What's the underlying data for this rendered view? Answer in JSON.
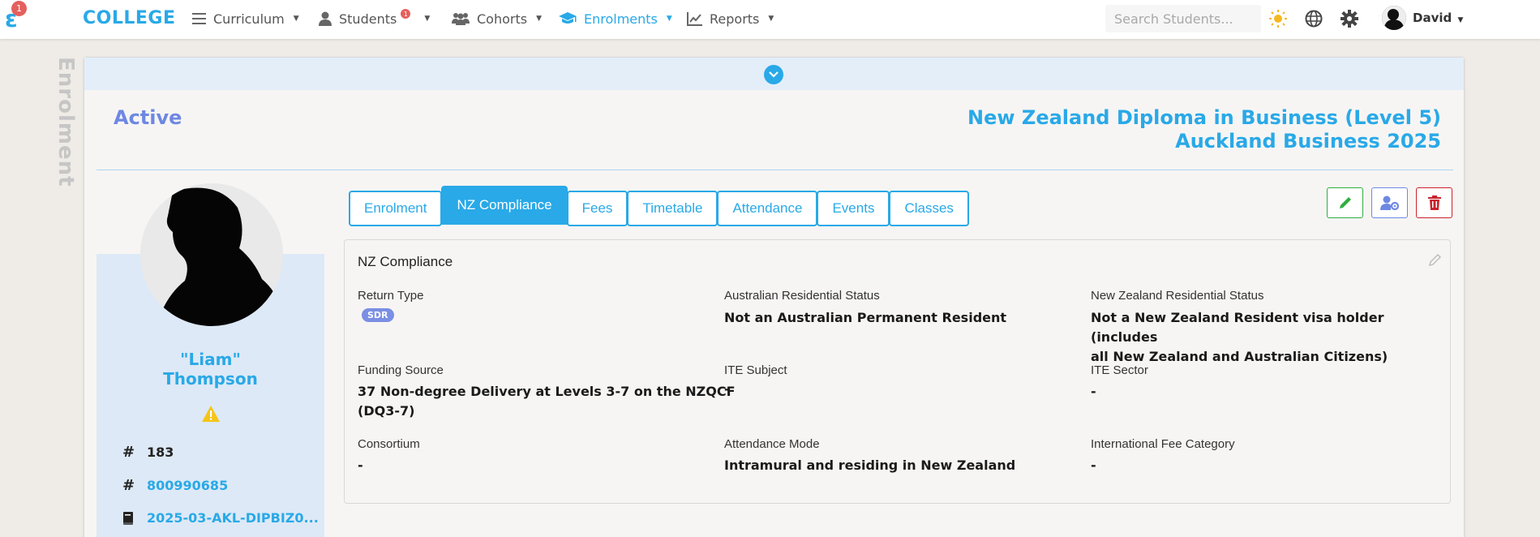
{
  "nav": {
    "brand": "COLLEGE",
    "logo_badge": "1",
    "items": [
      {
        "label": "Curriculum"
      },
      {
        "label": "Students",
        "badge": "1"
      },
      {
        "label": "Cohorts"
      },
      {
        "label": "Enrolments"
      },
      {
        "label": "Reports"
      }
    ],
    "search_placeholder": "Search Students...",
    "user": "David"
  },
  "page": {
    "side_label": "Enrolment",
    "status": "Active",
    "course_line1": "New Zealand Diploma in Business (Level 5)",
    "course_line2": "Auckland Business 2025"
  },
  "profile": {
    "name_line1": "\"Liam\"",
    "name_line2": "Thompson",
    "id_number": "183",
    "student_number": "800990685",
    "enrolment_code": "2025-03-AKL-DIPBIZ0..."
  },
  "tabs": [
    "Enrolment",
    "NZ Compliance",
    "Fees",
    "Timetable",
    "Attendance",
    "Events",
    "Classes"
  ],
  "compliance": {
    "title": "NZ Compliance",
    "return_type_label": "Return Type",
    "return_type_badge": "SDR",
    "aus_res_label": "Australian Residential Status",
    "aus_res_value": "Not an Australian Permanent Resident",
    "nz_res_label": "New Zealand Residential Status",
    "nz_res_value_1": "Not a New Zealand Resident visa holder (includes",
    "nz_res_value_2": "all New Zealand and Australian Citizens)",
    "funding_label": "Funding Source",
    "funding_value_1": "37 Non-degree Delivery at Levels 3-7 on the NZQCF",
    "funding_value_2": "(DQ3-7)",
    "ite_subject_label": "ITE Subject",
    "ite_subject_value": "-",
    "ite_sector_label": "ITE Sector",
    "ite_sector_value": "-",
    "consortium_label": "Consortium",
    "consortium_value": "-",
    "attendance_label": "Attendance Mode",
    "attendance_value": "Intramural and residing in New Zealand",
    "intl_fee_label": "International Fee Category",
    "intl_fee_value": "-"
  },
  "colors": {
    "accent": "#29a9e7",
    "status": "#6e88e2",
    "danger": "#c8232c",
    "success": "#2fae3d"
  }
}
